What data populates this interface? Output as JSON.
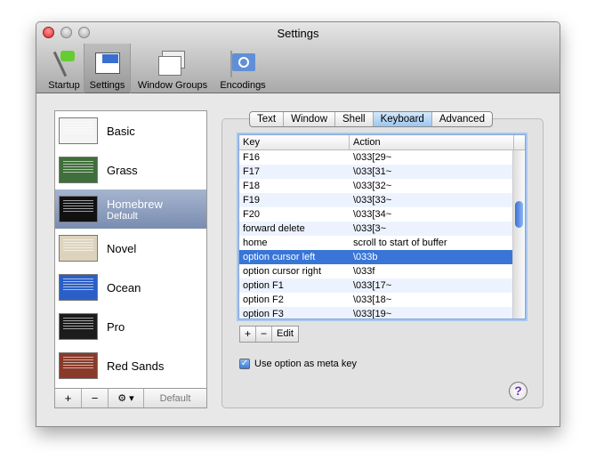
{
  "window": {
    "title": "Settings"
  },
  "toolbar": [
    {
      "label": "Startup",
      "icon": "flag-icon"
    },
    {
      "label": "Settings",
      "icon": "settings-icon"
    },
    {
      "label": "Window Groups",
      "icon": "window-groups-icon"
    },
    {
      "label": "Encodings",
      "icon": "un-flag-icon"
    }
  ],
  "profiles": [
    {
      "name": "Basic",
      "color": "#f4f4f4"
    },
    {
      "name": "Grass",
      "color": "#3f6f3a"
    },
    {
      "name": "Homebrew",
      "sub": "Default",
      "color": "#111111"
    },
    {
      "name": "Novel",
      "color": "#ddd3bd"
    },
    {
      "name": "Ocean",
      "color": "#2a5fc7"
    },
    {
      "name": "Pro",
      "color": "#1c1c1c"
    },
    {
      "name": "Red Sands",
      "color": "#8a3a2a"
    }
  ],
  "list_bar": {
    "add": "+",
    "remove": "−",
    "gear": "⚙ ▾",
    "default": "Default"
  },
  "tabs": [
    "Text",
    "Window",
    "Shell",
    "Keyboard",
    "Advanced"
  ],
  "table": {
    "headers": [
      "Key",
      "Action"
    ],
    "rows": [
      [
        "F16",
        "\\033[29~"
      ],
      [
        "F17",
        "\\033[31~"
      ],
      [
        "F18",
        "\\033[32~"
      ],
      [
        "F19",
        "\\033[33~"
      ],
      [
        "F20",
        "\\033[34~"
      ],
      [
        "forward delete",
        "\\033[3~"
      ],
      [
        "home",
        "scroll to start of buffer"
      ],
      [
        "option cursor left",
        "\\033b"
      ],
      [
        "option cursor right",
        "\\033f"
      ],
      [
        "option F1",
        "\\033[17~"
      ],
      [
        "option F2",
        "\\033[18~"
      ],
      [
        "option F3",
        "\\033[19~"
      ]
    ],
    "selected": 7
  },
  "table_buttons": {
    "add": "+",
    "remove": "−",
    "edit": "Edit"
  },
  "meta_key": {
    "label": "Use option as meta key",
    "checked": true
  },
  "help": "?"
}
